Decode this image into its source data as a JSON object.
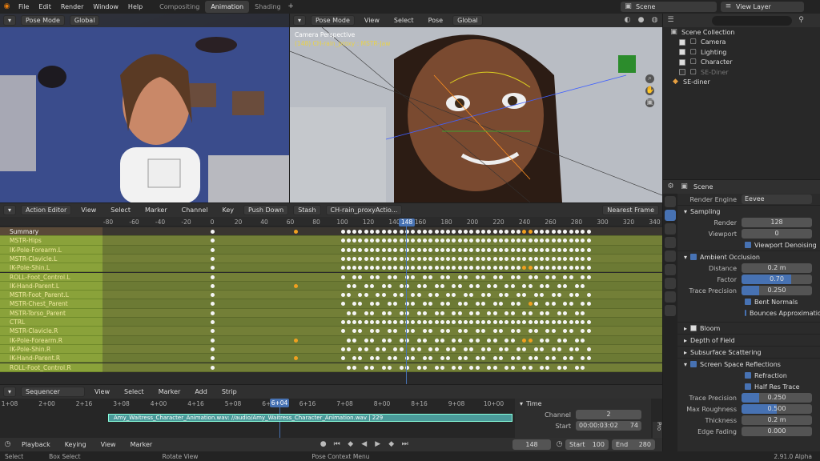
{
  "topbar": {
    "menus": [
      "File",
      "Edit",
      "Render",
      "Window",
      "Help"
    ],
    "workspaces": [
      "Compositing",
      "Animation",
      "Shading"
    ],
    "active_workspace": "Animation",
    "scene": "Scene",
    "view_layer": "View Layer"
  },
  "left_viewport": {
    "mode": "Pose Mode",
    "orientation": "Global"
  },
  "mid_viewport": {
    "mode": "Pose Mode",
    "menus": [
      "View",
      "Select",
      "Pose"
    ],
    "orientation": "Global",
    "camera_label": "Camera Perspective",
    "object_label": "(148) CH-rain_proxy : MSTR-Jaw"
  },
  "outliner": {
    "search_placeholder": "",
    "title": "Scene Collection",
    "items": [
      {
        "label": "Camera"
      },
      {
        "label": "Lighting"
      },
      {
        "label": "Character"
      },
      {
        "label": "SE-Diner"
      },
      {
        "label": "SE-diner"
      }
    ]
  },
  "properties": {
    "title": "Scene",
    "render_engine_label": "Render Engine",
    "render_engine": "Eevee",
    "sampling": "Sampling",
    "render_label": "Render",
    "render_val": "128",
    "viewport_label": "Viewport",
    "viewport_val": "0",
    "viewport_denoising": "Viewport Denoising",
    "ao": "Ambient Occlusion",
    "distance_label": "Distance",
    "distance_val": "0.2 m",
    "factor_label": "Factor",
    "factor_val": "0.70",
    "trace_precision_label": "Trace Precision",
    "trace_precision_val": "0.250",
    "bent_normals": "Bent Normals",
    "bounces": "Bounces Approximation",
    "bloom": "Bloom",
    "dof": "Depth of Field",
    "sss": "Subsurface Scattering",
    "ssr": "Screen Space Reflections",
    "refraction": "Refraction",
    "half_res": "Half Res Trace",
    "ssr_trace_label": "Trace Precision",
    "ssr_trace_val": "0.250",
    "max_rough_label": "Max Roughness",
    "max_rough_val": "0.500",
    "thickness_label": "Thickness",
    "thickness_val": "0.2 m",
    "edge_fading_label": "Edge Fading",
    "edge_fading_val": "0.000"
  },
  "action_editor": {
    "mode": "Action Editor",
    "menus": [
      "View",
      "Select",
      "Marker",
      "Channel",
      "Key"
    ],
    "push_down": "Push Down",
    "stash": "Stash",
    "action": "CH-rain_proxyActio...",
    "snap": "Nearest Frame",
    "current_frame": "148",
    "ticks": [
      "-80",
      "-60",
      "-40",
      "-20",
      "0",
      "20",
      "40",
      "60",
      "80",
      "100",
      "120",
      "140",
      "160",
      "180",
      "200",
      "220",
      "240",
      "260",
      "280",
      "300",
      "320",
      "340"
    ],
    "channels": [
      "Summary",
      "MSTR-Hips",
      "IK-Pole-Forearm.L",
      "MSTR-Clavicle.L",
      "IK-Pole-Shin.L",
      "ROLL-Foot_Control.L",
      "IK-Hand-Parent.L",
      "MSTR-Foot_Parent.L",
      "MSTR-Chest_Parent",
      "MSTR-Torso_Parent",
      "CTRL",
      "MSTR-Clavicle.R",
      "IK-Pole-Forearm.R",
      "IK-Pole-Shin.R",
      "IK-Hand-Parent.R",
      "ROLL-Foot_Control.R"
    ]
  },
  "sequencer": {
    "mode": "Sequencer",
    "menus": [
      "View",
      "Select",
      "Marker",
      "Add",
      "Strip"
    ],
    "ticks": [
      "1+08",
      "2+00",
      "2+16",
      "3+08",
      "4+00",
      "4+16",
      "5+08",
      "6+04",
      "6+16",
      "7+08",
      "8+00",
      "8+16",
      "9+08",
      "10+00"
    ],
    "current": "6+04",
    "strip": "Amy_Waitress_Character_Animation.wav: //audio/Amy_Waitress_Character_Animation.wav | 229",
    "time_panel": "Time",
    "channel_label": "Channel",
    "channel_val": "2",
    "start_label": "Start",
    "start_val": "00:00:03:02",
    "start_frames": "74",
    "tab_label": "Pro"
  },
  "timeline": {
    "menus": [
      "Playback",
      "Keying",
      "View",
      "Marker"
    ],
    "frame": "148",
    "start_label": "Start",
    "start": "100",
    "end_label": "End",
    "end": "280"
  },
  "statusbar": {
    "items": [
      "Select",
      "Box Select",
      "Rotate View",
      "Pose Context Menu"
    ],
    "version": "2.91.0 Alpha"
  }
}
